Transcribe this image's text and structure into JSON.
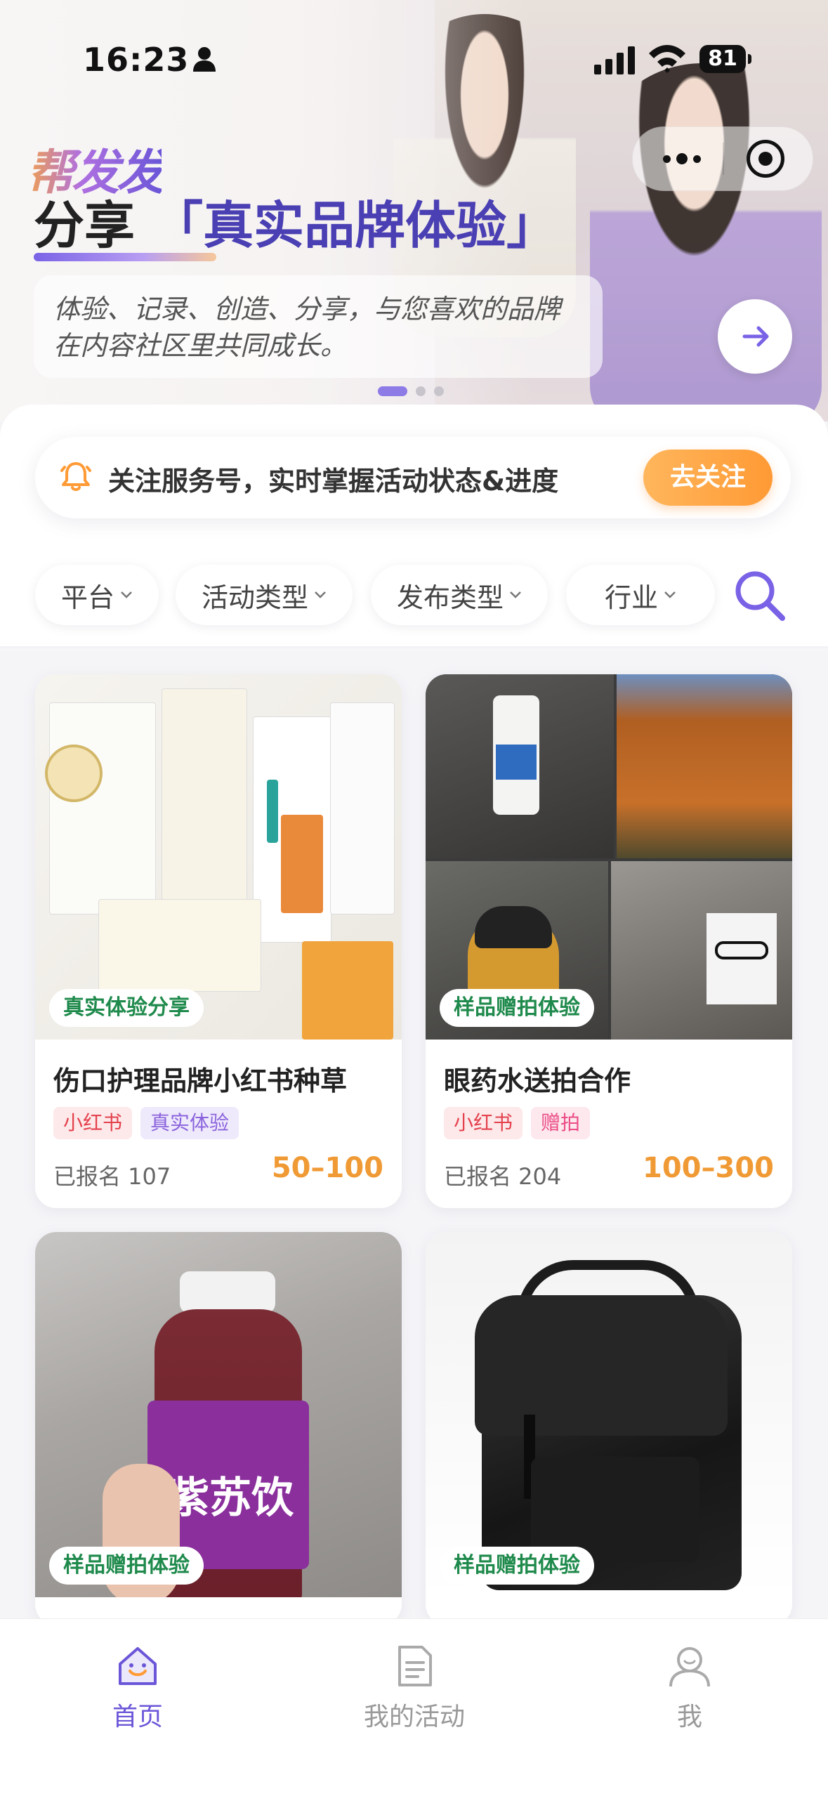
{
  "status_bar": {
    "time": "16:23",
    "battery": "81"
  },
  "banner": {
    "logo": "帮发发",
    "headline_prefix": "分享",
    "headline_highlight": "「真实品牌体验」",
    "description_line1": "体验、记录、创造、分享，与您喜欢的品牌",
    "description_line2": "在内容社区里共同成长。"
  },
  "notice": {
    "text": "关注服务号，实时掌握活动状态&进度",
    "button": "去关注"
  },
  "filters": [
    {
      "label": "平台"
    },
    {
      "label": "活动类型"
    },
    {
      "label": "发布类型"
    },
    {
      "label": "行业"
    }
  ],
  "cards": [
    {
      "badge": "真实体验分享",
      "title": "伤口护理品牌小红书种草",
      "tags": [
        "小红书",
        "真实体验"
      ],
      "signed": "已报名 107",
      "price": "50–100"
    },
    {
      "badge": "样品赠拍体验",
      "title": "眼药水送拍合作",
      "tags": [
        "小红书",
        "赠拍"
      ],
      "signed": "已报名 204",
      "price": "100–300"
    },
    {
      "badge": "样品赠拍体验",
      "product_text": "紫苏饮"
    },
    {
      "badge": "样品赠拍体验"
    }
  ],
  "tabbar": [
    {
      "label": "首页",
      "icon": "home-icon",
      "active": true
    },
    {
      "label": "我的活动",
      "icon": "document-icon",
      "active": false
    },
    {
      "label": "我",
      "icon": "profile-icon",
      "active": false
    }
  ],
  "colors": {
    "brand": "#6a56d8",
    "accent": "#ff9a35",
    "badge_green": "#1f8a4c",
    "price": "#f09a35"
  }
}
